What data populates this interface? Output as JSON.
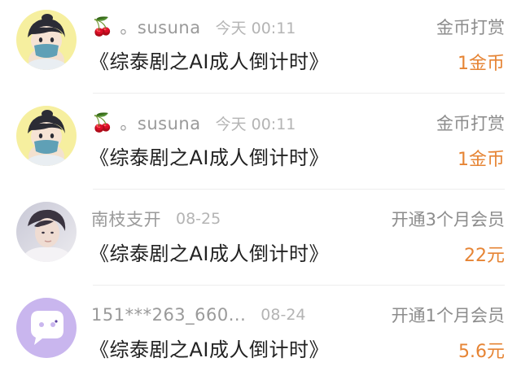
{
  "items": [
    {
      "avatar_icon": "anime-boy-avatar-icon",
      "prefix_icon": "cherry-icon",
      "prefix_glyph": "🍒",
      "nickname": "。susuna",
      "time": "今天 00:11",
      "book": "《综泰剧之AI成人倒计时》",
      "action": "金币打赏",
      "amount": "1金币"
    },
    {
      "avatar_icon": "anime-boy-avatar-icon",
      "prefix_icon": "cherry-icon",
      "prefix_glyph": "🍒",
      "nickname": "。susuna",
      "time": "今天 00:11",
      "book": "《综泰剧之AI成人倒计时》",
      "action": "金币打赏",
      "amount": "1金币"
    },
    {
      "avatar_icon": "photo-avatar-icon",
      "nickname": "南枝支开",
      "time": "08-25",
      "book": "《综泰剧之AI成人倒计时》",
      "action": "开通3个月会员",
      "amount": "22元"
    },
    {
      "avatar_icon": "default-chat-avatar-icon",
      "nickname": "151***263_660...",
      "time": "08-24",
      "book": "《综泰剧之AI成人倒计时》",
      "action": "开通1个月会员",
      "amount": "5.6元"
    }
  ],
  "colors": {
    "amount": "#e68434",
    "nickname": "#9a9a9a",
    "time": "#b4b4b4",
    "title": "#222222",
    "divider": "#eeeeee",
    "default_avatar_bg": "#c9b6ee"
  }
}
